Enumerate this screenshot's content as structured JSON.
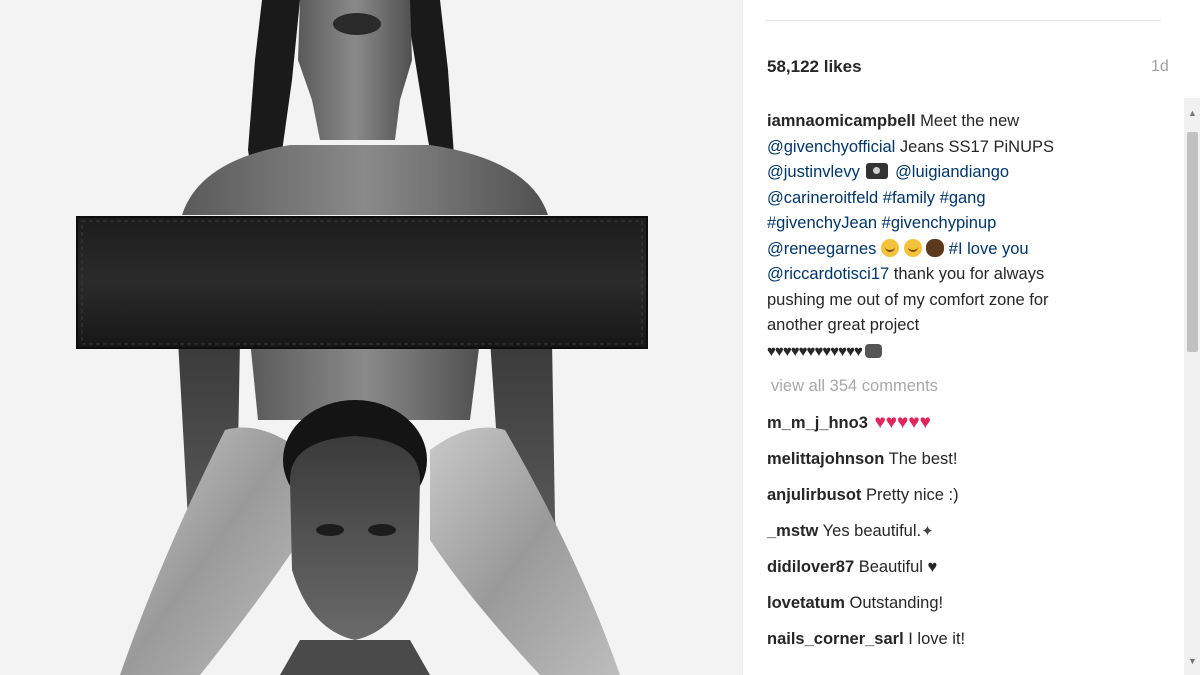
{
  "post": {
    "likes": "58,122 likes",
    "time": "1d",
    "caption": {
      "username": "iamnaomicampbell",
      "line1_text": " Meet the new",
      "line2_link": "@givenchyofficial",
      "line2_text": " Jeans SS17 PiNUPS",
      "line3_link1": "@justinvlevy",
      "line3_link2": "@luigiandiango",
      "line4": "@carineroitfeld #family #gang",
      "line5": "#givenchyJean #givenchypinup",
      "line6_link": "@reneegarnes",
      "line6_text": " #I love you",
      "line7_link": "@riccardotisci17",
      "line7_text": " thank you for always",
      "line8": "pushing me out of my comfort zone for",
      "line9": "another great project",
      "hearts": "♥♥♥♥♥♥♥♥♥♥♥♥"
    },
    "view_all": "view all 354 comments",
    "comments": [
      {
        "user": "m_m_j_hno3",
        "text": "",
        "hearts": "♥♥♥♥♥"
      },
      {
        "user": "melittajohnson",
        "text": " The best!"
      },
      {
        "user": "anjulirbusot",
        "text": " Pretty nice :)"
      },
      {
        "user": "_mstw",
        "text": " Yes beautiful.",
        "extra": "✦"
      },
      {
        "user": "didilover87",
        "text": " Beautiful ",
        "extra": "♥"
      },
      {
        "user": "lovetatum",
        "text": " Outstanding!"
      },
      {
        "user": "nails_corner_sarl",
        "text": " I love it!"
      }
    ]
  },
  "icons": {
    "camera": "camera-icon",
    "fist": "fist-bump-icon",
    "face": "kissing-face-icon",
    "clap": "clapping-hands-icon"
  },
  "colors": {
    "link": "#003569",
    "muted": "#a8a8a8",
    "heart_red": "#e0245e"
  }
}
